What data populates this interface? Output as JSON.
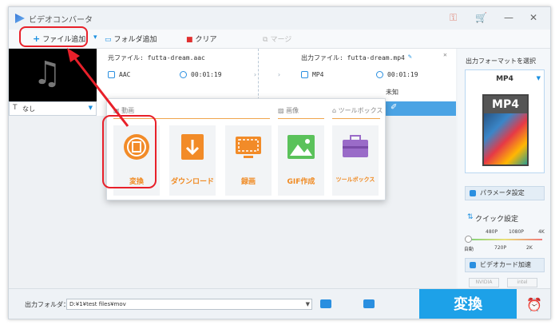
{
  "app": {
    "title": "ビデオコンバータ"
  },
  "toolbar": {
    "add_file": "ファイル追加",
    "add_folder": "フォルダ追加",
    "clear": "クリア",
    "merge": "マージ"
  },
  "file_item": {
    "subtitle_select": "なし",
    "source_label": "元ファイル: futta-dream.aac",
    "source_format": "AAC",
    "source_duration": "00:01:19",
    "output_label": "出力ファイル: futta-dream.mp4",
    "output_format": "MP4",
    "output_duration": "00:01:19",
    "output_extra": "未知"
  },
  "popup": {
    "categories": {
      "video": "動画",
      "image": "画像",
      "toolbox": "ツールボックス"
    },
    "tiles": [
      {
        "label": "変換",
        "icon": "convert-film-icon"
      },
      {
        "label": "ダウンロード",
        "icon": "download-icon"
      },
      {
        "label": "録画",
        "icon": "screen-record-icon"
      },
      {
        "label": "GIF作成",
        "icon": "gif-image-icon"
      },
      {
        "label": "ツールボックス",
        "icon": "toolbox-icon"
      }
    ]
  },
  "right_panel": {
    "title": "出力フォーマットを選択",
    "format": "MP4",
    "format_art_text": "MP4",
    "param_button": "パラメータ設定",
    "quick_setting_title": "クイック設定",
    "quality_top": [
      "480P",
      "1080P",
      "4K"
    ],
    "quality_bottom": [
      "自動",
      "720P",
      "2K"
    ],
    "quality_level": 0,
    "gpu_button": "ビデオカード加速",
    "hw_labels": [
      "NVIDIA",
      "intel"
    ]
  },
  "bottom": {
    "output_folder_label": "出力フォルダ：",
    "output_path": "D:¥1¥test files¥mov",
    "convert_button": "変換"
  },
  "colors": {
    "accent": "#1da1e8",
    "orange": "#f08a22",
    "highlight": "#e8202a"
  }
}
